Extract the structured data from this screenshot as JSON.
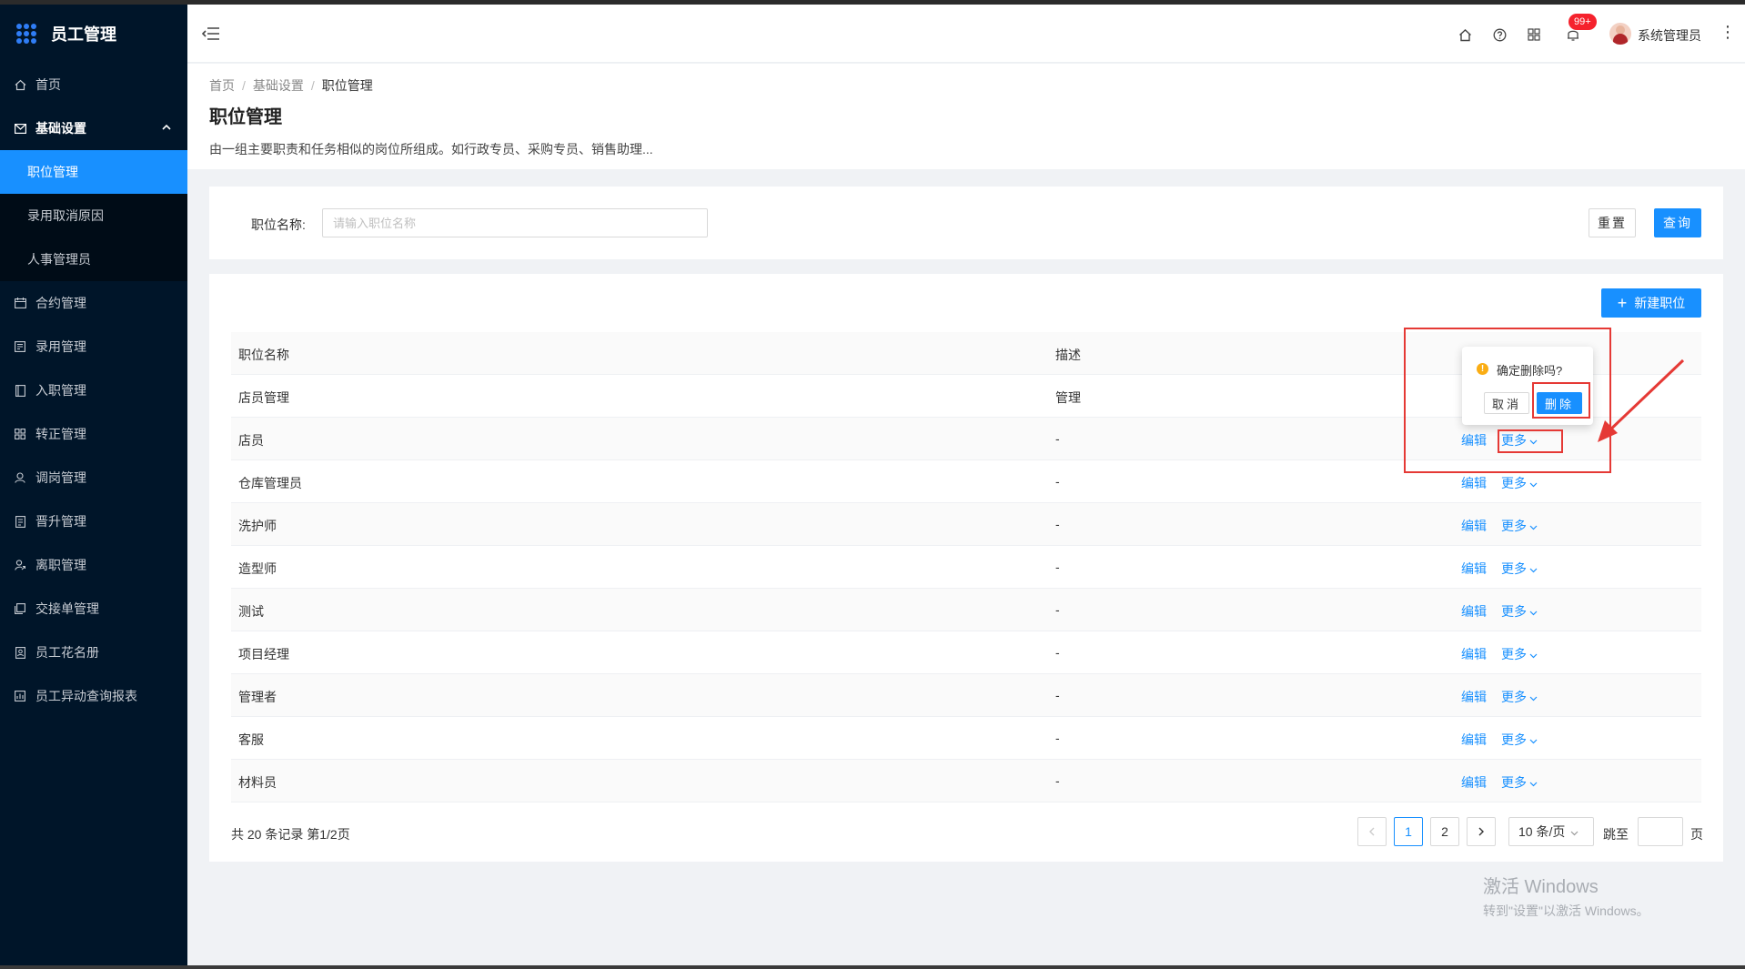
{
  "app": {
    "title": "员工管理"
  },
  "sidebar": {
    "items": [
      {
        "label": "首页",
        "icon": "home-icon"
      },
      {
        "label": "基础设置",
        "icon": "mail-icon",
        "open": true,
        "children": [
          {
            "label": "职位管理",
            "active": true
          },
          {
            "label": "录用取消原因"
          },
          {
            "label": "人事管理员"
          }
        ]
      },
      {
        "label": "合约管理",
        "icon": "calendar-icon"
      },
      {
        "label": "录用管理",
        "icon": "form-icon"
      },
      {
        "label": "入职管理",
        "icon": "book-icon"
      },
      {
        "label": "转正管理",
        "icon": "grid-icon"
      },
      {
        "label": "调岗管理",
        "icon": "user-icon"
      },
      {
        "label": "晋升管理",
        "icon": "doc-icon"
      },
      {
        "label": "离职管理",
        "icon": "leave-icon"
      },
      {
        "label": "交接单管理",
        "icon": "copy-icon"
      },
      {
        "label": "员工花名册",
        "icon": "roster-icon"
      },
      {
        "label": "员工异动查询报表",
        "icon": "report-icon"
      }
    ]
  },
  "header": {
    "notification_count": "99+",
    "username": "系统管理员"
  },
  "breadcrumb": [
    "首页",
    "基础设置",
    "职位管理"
  ],
  "page": {
    "title": "职位管理",
    "description": "由一组主要职责和任务相似的岗位所组成。如行政专员、采购专员、销售助理..."
  },
  "search": {
    "label": "职位名称:",
    "placeholder": "请输入职位名称",
    "reset_label": "重置",
    "query_label": "查询"
  },
  "table": {
    "new_button_label": "新建职位",
    "columns": [
      "职位名称",
      "描述"
    ],
    "edit_label": "编辑",
    "more_label": "更多",
    "rows": [
      {
        "name": "店员管理",
        "desc": "管理"
      },
      {
        "name": "店员",
        "desc": "-"
      },
      {
        "name": "仓库管理员",
        "desc": "-"
      },
      {
        "name": "洗护师",
        "desc": "-"
      },
      {
        "name": "造型师",
        "desc": "-"
      },
      {
        "name": "测试",
        "desc": "-"
      },
      {
        "name": "项目经理",
        "desc": "-"
      },
      {
        "name": "管理者",
        "desc": "-"
      },
      {
        "name": "客服",
        "desc": "-"
      },
      {
        "name": "材料员",
        "desc": "-"
      }
    ]
  },
  "pagination": {
    "total_text": "共 20 条记录 第1/2页",
    "pages": [
      "1",
      "2"
    ],
    "current": "1",
    "page_size": "10 条/页",
    "jump_label": "跳至",
    "page_suffix": "页"
  },
  "popconfirm": {
    "message": "确定删除吗?",
    "cancel_label": "取消",
    "ok_label": "删除"
  },
  "watermark": {
    "line1": "激活 Windows",
    "line2": "转到\"设置\"以激活 Windows。"
  },
  "colors": {
    "primary": "#1890ff",
    "sidebar_bg": "#001529",
    "annotation": "#e53935",
    "badge": "#f5222d"
  }
}
